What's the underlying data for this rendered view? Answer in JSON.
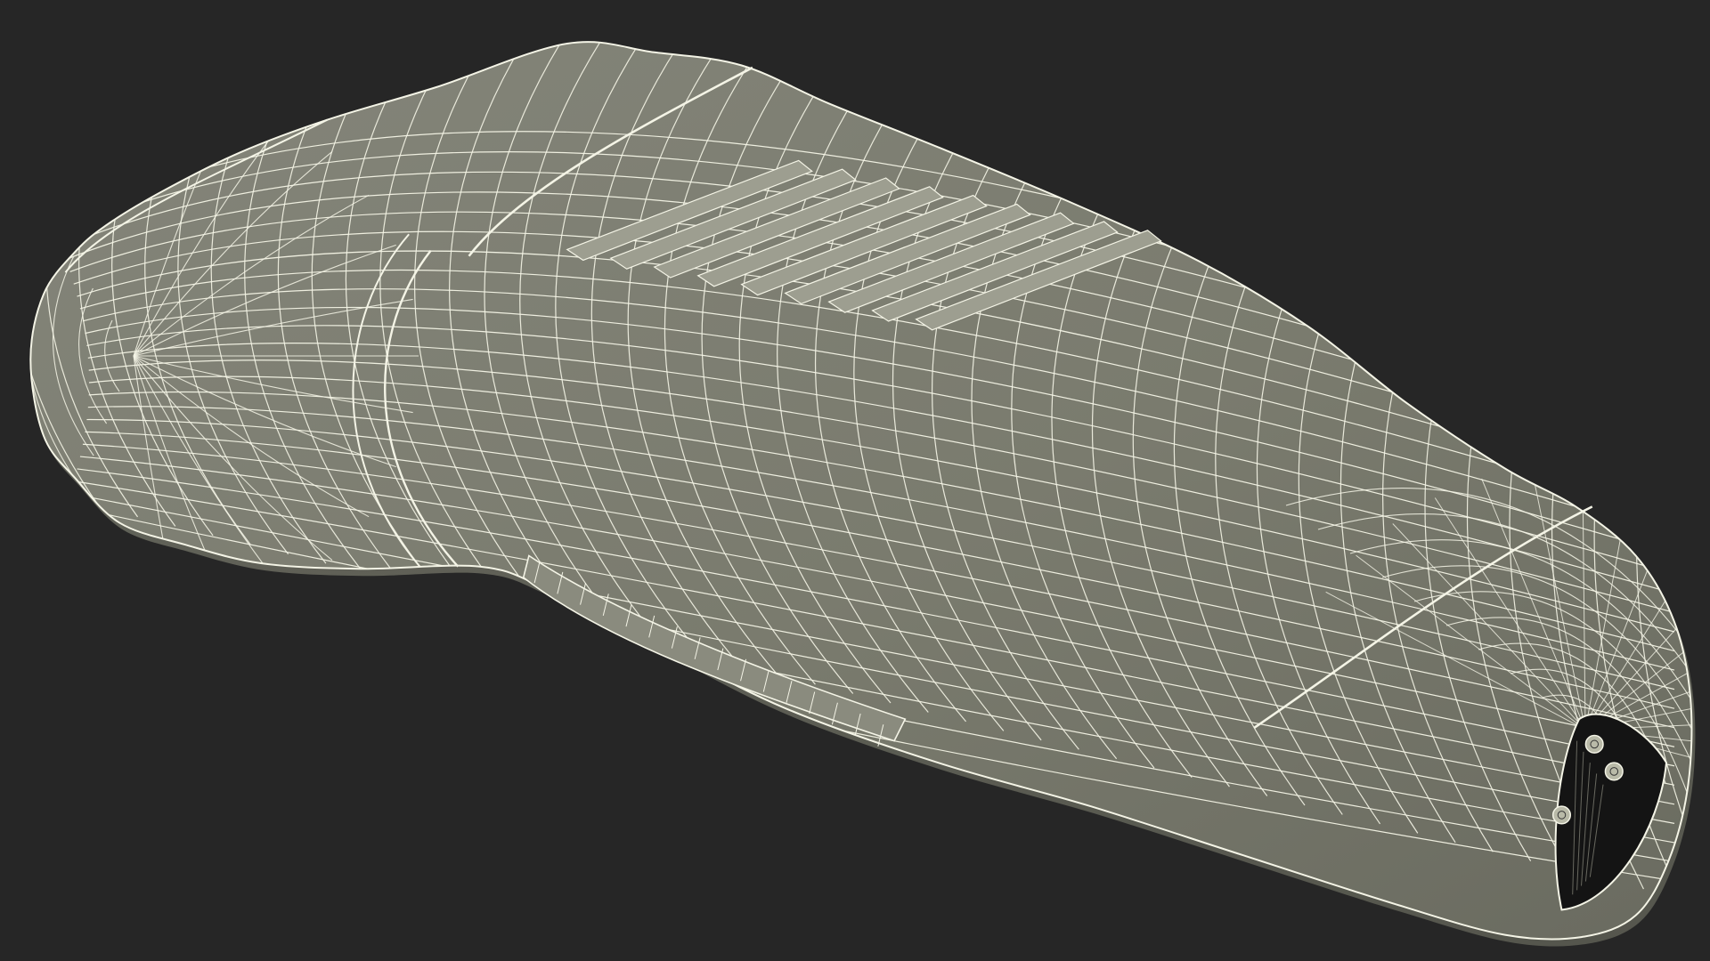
{
  "scene": {
    "subject": "wireframe-3d-model",
    "background_color": "#262626",
    "surface_color": "#7a7b6e",
    "surface_shadow_color": "#5f6056",
    "wire_color": "#f4f4e6",
    "vent_color": "#9d9e90",
    "opening_color": "#141414"
  }
}
